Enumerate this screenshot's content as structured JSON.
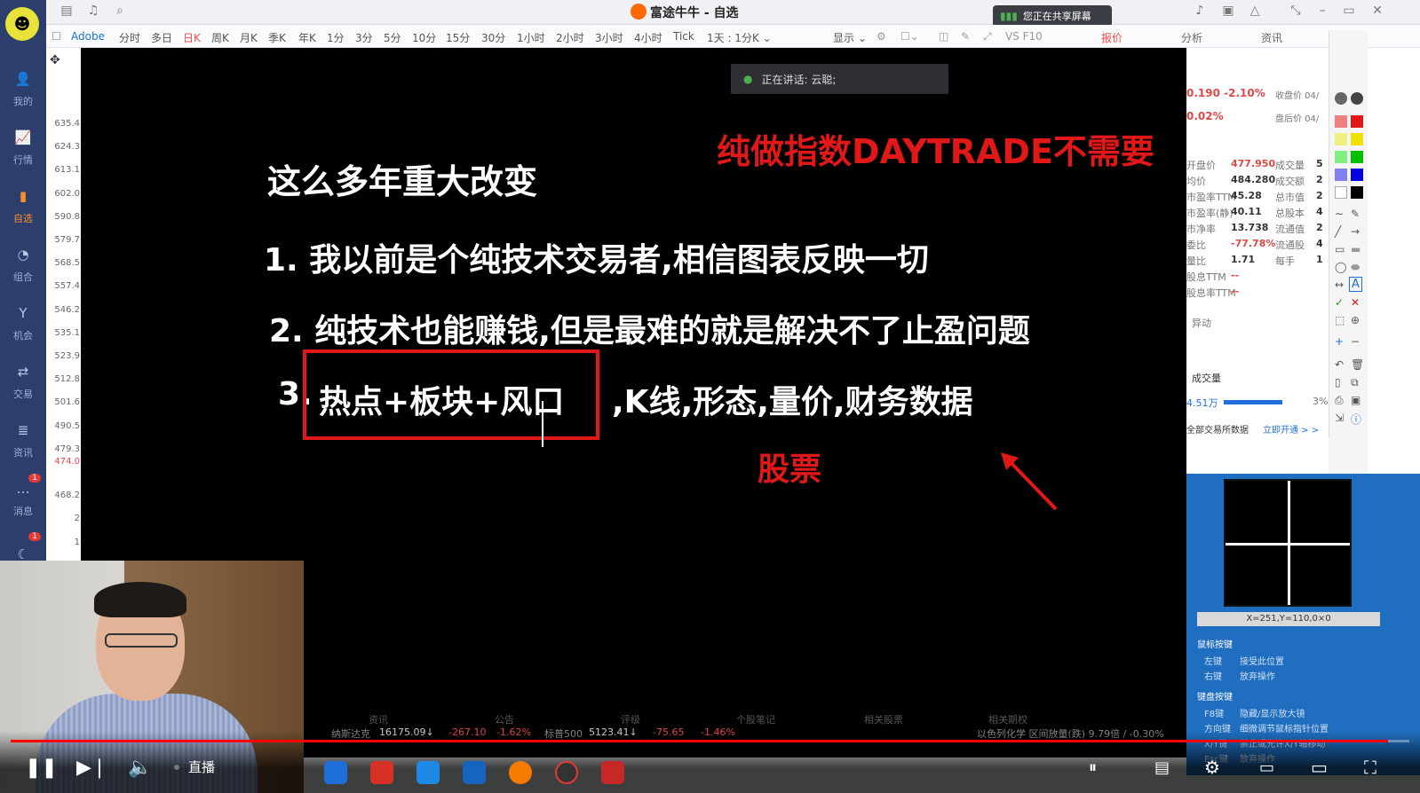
{
  "window": {
    "title": "富途牛牛 - 自选",
    "sharing_notice": "您正在共享屏幕"
  },
  "sidebar": {
    "items": [
      {
        "label": "我的",
        "icon": "user-icon"
      },
      {
        "label": "行情",
        "icon": "chart-line-icon"
      },
      {
        "label": "自选",
        "icon": "bar-chart-icon"
      },
      {
        "label": "组合",
        "icon": "pie-icon"
      },
      {
        "label": "机会",
        "icon": "cup-icon"
      },
      {
        "label": "交易",
        "icon": "trade-icon"
      },
      {
        "label": "资讯",
        "icon": "news-icon"
      },
      {
        "label": "消息",
        "icon": "message-icon",
        "badge": "1"
      },
      {
        "label": "",
        "icon": "moon-icon",
        "badge": "1"
      }
    ]
  },
  "tabs": {
    "symbol": "Adobe",
    "periods": [
      "分时",
      "多日",
      "日K",
      "周K",
      "月K",
      "季K",
      "年K",
      "1分",
      "3分",
      "5分",
      "10分",
      "15分",
      "30分",
      "1小时",
      "2小时",
      "3小时",
      "4小时",
      "Tick",
      "1天 : 1分K ⌄"
    ],
    "display": "显示 ⌄",
    "vs": "VS F10",
    "right_tabs": [
      "报价",
      "分析",
      "资讯"
    ]
  },
  "price_axis": [
    "635.4",
    "624.3",
    "613.1",
    "602.0",
    "590.8",
    "579.7",
    "568.5",
    "557.4",
    "546.2",
    "535.1",
    "523.9",
    "512.8",
    "501.6",
    "490.5",
    "479.3",
    "474.0",
    "468.2",
    "2",
    "1"
  ],
  "voice": {
    "speaking": "正在讲话:  云聪;"
  },
  "slide": {
    "red_title": "纯做指数DAYTRADE不需要",
    "heading": "这么多年重大改变",
    "line1": "1. 我以前是个纯技术交易者,相信图表反映一切",
    "line2": "2. 纯技术也能赚钱,但是最难的就是解决不了止盈问题",
    "line3_num": "3.",
    "line3_boxed": "热点+板块+风口",
    "line3_rest": ",K线,形态,量价,财务数据",
    "red_note": "股票"
  },
  "quote": {
    "change": "0.190 -2.10%",
    "change2": "0.02%",
    "close_label": "收盘价 04/",
    "after_label": "盘后价 04/",
    "rows": [
      {
        "label": "开盘价",
        "value": "477.950",
        "label2": "成交量",
        "value2": "5"
      },
      {
        "label": "均价",
        "value": "484.280",
        "label2": "成交额",
        "value2": "2"
      },
      {
        "label": "市盈率TTM",
        "value": "45.28",
        "label2": "总市值",
        "value2": "2"
      },
      {
        "label": "市盈率(静)",
        "value": "40.11",
        "label2": "总股本",
        "value2": "4"
      },
      {
        "label": "市净率",
        "value": "13.738",
        "label2": "流通值",
        "value2": "2"
      },
      {
        "label": "委比",
        "value": "-77.78%",
        "label2": "流通股",
        "value2": "4"
      },
      {
        "label": "量比",
        "value": "1.71",
        "label2": "每手",
        "value2": "1"
      },
      {
        "label": "股息TTM",
        "value": "--",
        "label2": "",
        "value2": ""
      },
      {
        "label": "股息率TTM",
        "value": "--",
        "label2": "",
        "value2": ""
      }
    ],
    "abnormal": "异动",
    "volume_label": "成交量",
    "volume_value": "4.51万",
    "volume_pct": "3%",
    "all_exchanges": "全部交易所数据",
    "activate": "立即开通 > >"
  },
  "magnifier": {
    "coords": "X=251,Y=110,0×0",
    "mouse_title": "鼠标按键",
    "mouse_rows": [
      [
        "左键",
        "接受此位置"
      ],
      [
        "右键",
        "放弃操作"
      ]
    ],
    "kbd_title": "键盘按键",
    "kbd_rows": [
      [
        "F8键",
        "隐藏/显示放大镜"
      ],
      [
        "方向键",
        "细微调节鼠标指针位置"
      ],
      [
        "X/Y键",
        "禁止或允许X/Y轴移动"
      ],
      [
        "Esc键",
        "放弃操作"
      ]
    ]
  },
  "bottom_tabs": [
    "资讯",
    "公告",
    "评级",
    "个股笔记",
    "相关股票",
    "相关期权"
  ],
  "ticker": {
    "nasdaq_label": "纳斯达克",
    "nasdaq_value": "16175.09↓",
    "nasdaq_change": "-267.10",
    "nasdaq_pct": "-1.62%",
    "sp_label": "标普500",
    "sp_value": "5123.41↓",
    "sp_change": "-75.65",
    "sp_pct": "-1.46%",
    "news": "以色列化学  区间放量(跌) 9.79倍 / -0.30%"
  },
  "video": {
    "live_label": "直播",
    "progress": 0.985
  },
  "colors": {
    "accent_red": "#e01818",
    "sidebar": "#2c3e6b",
    "magnifier": "#1f6ec0"
  }
}
